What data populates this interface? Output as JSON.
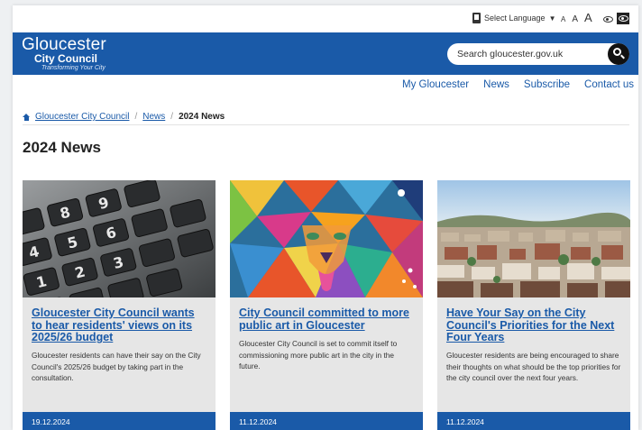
{
  "utility": {
    "language_label": "Select Language",
    "language_caret": "▼",
    "text_small": "A",
    "text_medium": "A",
    "text_large": "A"
  },
  "header": {
    "logo_line1": "Gloucester",
    "logo_line2": "City Council",
    "logo_tagline": "Transforming Your City",
    "search_placeholder": "Search gloucester.gov.uk",
    "brand_color": "#1a5aa8"
  },
  "subnav": {
    "items": [
      "My Gloucester",
      "News",
      "Subscribe",
      "Contact us"
    ]
  },
  "breadcrumb": {
    "home": "Gloucester City Council",
    "section": "News",
    "current": "2024 News",
    "separator": "/"
  },
  "page_title": "2024 News",
  "cards": [
    {
      "image": "calculator-keys",
      "title": "Gloucester City Council wants to hear residents' views on its 2025/26 budget",
      "description": "Gloucester residents can have their say on the City Council's 2025/26 budget by taking part in the consultation.",
      "date": "19.12.2024"
    },
    {
      "image": "colourful-lion-mural",
      "title": "City Council committed to more public art in Gloucester",
      "description": "Gloucester City Council is set to commit itself to commissioning more public art in the city in the future.",
      "date": "11.12.2024"
    },
    {
      "image": "city-aerial-view",
      "title": "Have Your Say on the City Council's Priorities for the Next Four Years",
      "description": "Gloucester residents are being encouraged to share their thoughts on what should be the top priorities for the city council over the next four years.",
      "date": "11.12.2024"
    }
  ]
}
